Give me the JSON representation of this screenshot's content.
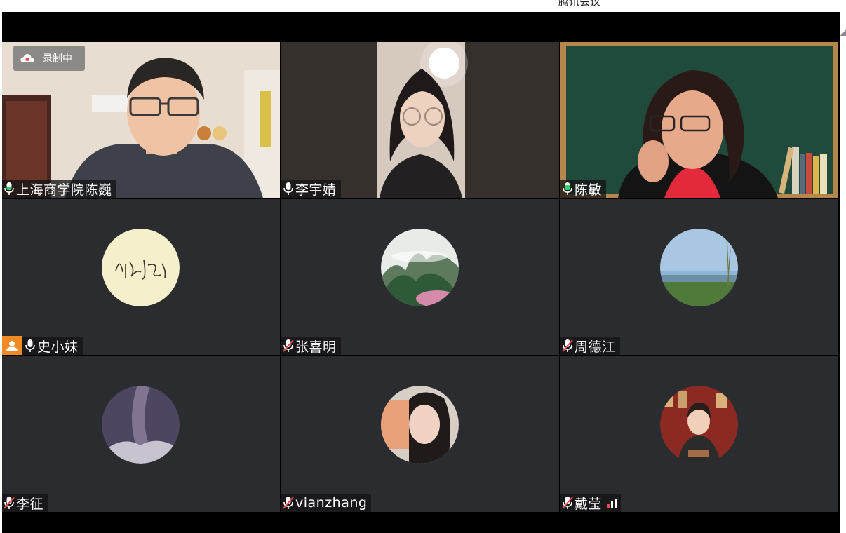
{
  "app": {
    "window_title": "腾讯会议"
  },
  "recording": {
    "label": "录制中"
  },
  "participants": [
    {
      "name": "上海商学院陈巍",
      "mic": "on",
      "view": "video"
    },
    {
      "name": "李宇婧",
      "mic": "on",
      "view": "video"
    },
    {
      "name": "陈敏",
      "mic": "on",
      "view": "video",
      "speaking": true
    },
    {
      "name": "史小妹",
      "mic": "on",
      "view": "avatar",
      "host_badge": true
    },
    {
      "name": "张喜明",
      "mic": "muted",
      "view": "avatar"
    },
    {
      "name": "周德江",
      "mic": "muted",
      "view": "avatar"
    },
    {
      "name": "李征",
      "mic": "muted",
      "view": "avatar"
    },
    {
      "name": "vianzhang",
      "mic": "muted",
      "view": "avatar"
    },
    {
      "name": "戴莹",
      "mic": "muted",
      "view": "avatar",
      "signal": "weak"
    }
  ],
  "colors": {
    "mic_active": "#2fd26b",
    "mic_muted": "#e94b4b",
    "tile_bg": "#2b2c2f",
    "host_badge": "#f08a24"
  },
  "icons": {
    "mic_on": "mic-icon",
    "mic_muted": "mic-muted-icon",
    "recording": "cloud-icon",
    "host": "user-icon",
    "signal": "signal-icon"
  }
}
